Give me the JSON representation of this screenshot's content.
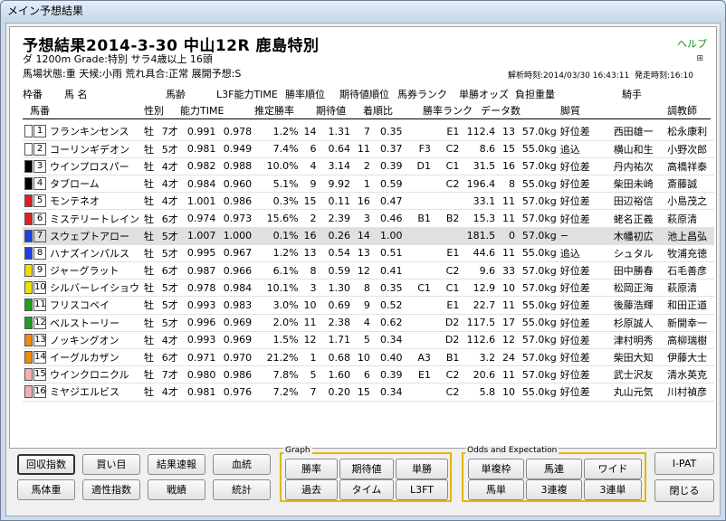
{
  "window_title": "メイン予想結果",
  "header": {
    "title": "予想結果2014-3-30 中山12R 鹿島特別",
    "help": "ヘルプ",
    "info_line1": "ダ 1200m  Grade:特別 サラ4歳以上 16頭",
    "info_line2": "馬場状態:重    天候:小雨    荒れ具合:正常    展開予想:S",
    "analysis_time": "解析時刻:2014/03/30 16:43:11",
    "post_time": "発走時刻:16:10",
    "mini_icon": "⊞"
  },
  "columns_top": [
    "枠番",
    "馬 名",
    "馬齢",
    "L3F能力TIME",
    "勝率順位",
    "期待値順位",
    "馬券ランク",
    "単勝オッズ",
    "負担重量",
    "騎手"
  ],
  "columns_bottom": [
    "馬番",
    "性別",
    "能力TIME",
    "推定勝率",
    "期待値",
    "着順比",
    "勝率ランク",
    "データ数",
    "脚質",
    "調教師"
  ],
  "rows": [
    {
      "waku": "1",
      "waku_color": "#ffffff",
      "uma": "1",
      "name": "フランキンセンス",
      "sex": "牡",
      "age": "7才",
      "time": "0.991",
      "l3f": "0.978",
      "winrate": "1.2%",
      "wrank": "14",
      "ev": "1.31",
      "evrank": "7",
      "ratio": "0.35",
      "bet": "",
      "rate": "E1",
      "odds": "112.4",
      "data": "13",
      "weight": "57.0kg",
      "style": "好位差",
      "jockey": "西田雄一",
      "trainer": "松永康利"
    },
    {
      "waku": "1",
      "waku_color": "#ffffff",
      "uma": "2",
      "name": "コーリンギデオン",
      "sex": "牡",
      "age": "5才",
      "time": "0.981",
      "l3f": "0.949",
      "winrate": "7.4%",
      "wrank": "6",
      "ev": "0.64",
      "evrank": "11",
      "ratio": "0.37",
      "bet": "F3",
      "rate": "C2",
      "odds": "8.6",
      "data": "15",
      "weight": "55.0kg",
      "style": "追込",
      "jockey": "横山和生",
      "trainer": "小野次郎"
    },
    {
      "waku": "2",
      "waku_color": "#000000",
      "uma": "3",
      "name": "ウインプロスパー",
      "sex": "牡",
      "age": "4才",
      "time": "0.982",
      "l3f": "0.988",
      "winrate": "10.0%",
      "wrank": "4",
      "ev": "3.14",
      "evrank": "2",
      "ratio": "0.39",
      "bet": "D1",
      "rate": "C1",
      "odds": "31.5",
      "data": "16",
      "weight": "57.0kg",
      "style": "好位差",
      "jockey": "丹内祐次",
      "trainer": "高橋祥泰"
    },
    {
      "waku": "2",
      "waku_color": "#000000",
      "uma": "4",
      "name": "タブローム",
      "sex": "牡",
      "age": "4才",
      "time": "0.984",
      "l3f": "0.960",
      "winrate": "5.1%",
      "wrank": "9",
      "ev": "9.92",
      "evrank": "1",
      "ratio": "0.59",
      "bet": "",
      "rate": "C2",
      "odds": "196.4",
      "data": "8",
      "weight": "55.0kg",
      "style": "好位差",
      "jockey": "柴田未崎",
      "trainer": "斎藤誠"
    },
    {
      "waku": "3",
      "waku_color": "#e02020",
      "uma": "5",
      "name": "モンテネオ",
      "sex": "牡",
      "age": "4才",
      "time": "1.001",
      "l3f": "0.986",
      "winrate": "0.3%",
      "wrank": "15",
      "ev": "0.11",
      "evrank": "16",
      "ratio": "0.47",
      "bet": "",
      "rate": "",
      "odds": "33.1",
      "data": "11",
      "weight": "57.0kg",
      "style": "好位差",
      "jockey": "田辺裕信",
      "trainer": "小島茂之"
    },
    {
      "waku": "3",
      "waku_color": "#e02020",
      "uma": "6",
      "name": "ミステリートレイン",
      "sex": "牡",
      "age": "6才",
      "time": "0.974",
      "l3f": "0.973",
      "winrate": "15.6%",
      "wrank": "2",
      "ev": "2.39",
      "evrank": "3",
      "ratio": "0.46",
      "bet": "B1",
      "rate": "B2",
      "odds": "15.3",
      "data": "11",
      "weight": "57.0kg",
      "style": "好位差",
      "jockey": "蛯名正義",
      "trainer": "萩原清"
    },
    {
      "waku": "4",
      "waku_color": "#2040e0",
      "uma": "7",
      "name": "スウェプトアロー",
      "sex": "牡",
      "age": "5才",
      "time": "1.007",
      "l3f": "1.000",
      "winrate": "0.1%",
      "wrank": "16",
      "ev": "0.26",
      "evrank": "14",
      "ratio": "1.00",
      "bet": "",
      "rate": "",
      "odds": "181.5",
      "data": "0",
      "weight": "57.0kg",
      "style": "−",
      "jockey": "木幡初広",
      "trainer": "池上昌弘",
      "hl": true
    },
    {
      "waku": "4",
      "waku_color": "#2040e0",
      "uma": "8",
      "name": "ハナズインパルス",
      "sex": "牡",
      "age": "5才",
      "time": "0.995",
      "l3f": "0.967",
      "winrate": "1.2%",
      "wrank": "13",
      "ev": "0.54",
      "evrank": "13",
      "ratio": "0.51",
      "bet": "",
      "rate": "E1",
      "odds": "44.6",
      "data": "11",
      "weight": "55.0kg",
      "style": "追込",
      "jockey": "シュタル",
      "trainer": "牧浦充徳"
    },
    {
      "waku": "5",
      "waku_color": "#f0e000",
      "uma": "9",
      "name": "ジャーグラット",
      "sex": "牡",
      "age": "6才",
      "time": "0.987",
      "l3f": "0.966",
      "winrate": "6.1%",
      "wrank": "8",
      "ev": "0.59",
      "evrank": "12",
      "ratio": "0.41",
      "bet": "",
      "rate": "C2",
      "odds": "9.6",
      "data": "33",
      "weight": "57.0kg",
      "style": "好位差",
      "jockey": "田中勝春",
      "trainer": "石毛善彦"
    },
    {
      "waku": "5",
      "waku_color": "#f0e000",
      "uma": "10",
      "name": "シルバーレイショウ",
      "sex": "牡",
      "age": "5才",
      "time": "0.978",
      "l3f": "0.984",
      "winrate": "10.1%",
      "wrank": "3",
      "ev": "1.30",
      "evrank": "8",
      "ratio": "0.35",
      "bet": "C1",
      "rate": "C1",
      "odds": "12.9",
      "data": "10",
      "weight": "57.0kg",
      "style": "好位差",
      "jockey": "松岡正海",
      "trainer": "萩原清"
    },
    {
      "waku": "6",
      "waku_color": "#20a020",
      "uma": "11",
      "name": "フリスコベイ",
      "sex": "牡",
      "age": "5才",
      "time": "0.993",
      "l3f": "0.983",
      "winrate": "3.0%",
      "wrank": "10",
      "ev": "0.69",
      "evrank": "9",
      "ratio": "0.52",
      "bet": "",
      "rate": "E1",
      "odds": "22.7",
      "data": "11",
      "weight": "55.0kg",
      "style": "好位差",
      "jockey": "後藤浩輝",
      "trainer": "和田正道"
    },
    {
      "waku": "6",
      "waku_color": "#20a020",
      "uma": "12",
      "name": "ベルストーリー",
      "sex": "牡",
      "age": "5才",
      "time": "0.996",
      "l3f": "0.969",
      "winrate": "2.0%",
      "wrank": "11",
      "ev": "2.38",
      "evrank": "4",
      "ratio": "0.62",
      "bet": "",
      "rate": "D2",
      "odds": "117.5",
      "data": "17",
      "weight": "55.0kg",
      "style": "好位差",
      "jockey": "杉原誠人",
      "trainer": "新開幸一"
    },
    {
      "waku": "7",
      "waku_color": "#f08a10",
      "uma": "13",
      "name": "ノッキングオン",
      "sex": "牡",
      "age": "4才",
      "time": "0.993",
      "l3f": "0.969",
      "winrate": "1.5%",
      "wrank": "12",
      "ev": "1.71",
      "evrank": "5",
      "ratio": "0.34",
      "bet": "",
      "rate": "D2",
      "odds": "112.6",
      "data": "12",
      "weight": "57.0kg",
      "style": "好位差",
      "jockey": "津村明秀",
      "trainer": "高柳瑞樹"
    },
    {
      "waku": "7",
      "waku_color": "#f08a10",
      "uma": "14",
      "name": "イーグルカザン",
      "sex": "牡",
      "age": "6才",
      "time": "0.971",
      "l3f": "0.970",
      "winrate": "21.2%",
      "wrank": "1",
      "ev": "0.68",
      "evrank": "10",
      "ratio": "0.40",
      "bet": "A3",
      "rate": "B1",
      "odds": "3.2",
      "data": "24",
      "weight": "57.0kg",
      "style": "好位差",
      "jockey": "柴田大知",
      "trainer": "伊藤大士"
    },
    {
      "waku": "8",
      "waku_color": "#f6b0b0",
      "uma": "15",
      "name": "ウインクロニクル",
      "sex": "牡",
      "age": "7才",
      "time": "0.980",
      "l3f": "0.986",
      "winrate": "7.8%",
      "wrank": "5",
      "ev": "1.60",
      "evrank": "6",
      "ratio": "0.39",
      "bet": "E1",
      "rate": "C2",
      "odds": "20.6",
      "data": "11",
      "weight": "57.0kg",
      "style": "好位差",
      "jockey": "武士沢友",
      "trainer": "清水英克"
    },
    {
      "waku": "8",
      "waku_color": "#f6b0b0",
      "uma": "16",
      "name": "ミヤジエルビス",
      "sex": "牡",
      "age": "4才",
      "time": "0.981",
      "l3f": "0.976",
      "winrate": "7.2%",
      "wrank": "7",
      "ev": "0.20",
      "evrank": "15",
      "ratio": "0.34",
      "bet": "",
      "rate": "C2",
      "odds": "5.8",
      "data": "10",
      "weight": "55.0kg",
      "style": "好位差",
      "jockey": "丸山元気",
      "trainer": "川村禎彦"
    }
  ],
  "buttons_left": [
    "回収指数",
    "買い目",
    "結果速報",
    "血統",
    "馬体重",
    "適性指数",
    "戦績",
    "統計"
  ],
  "graph_group": {
    "label": "Graph",
    "buttons": [
      "勝率",
      "期待値",
      "単勝",
      "過去",
      "タイム",
      "L3FT"
    ]
  },
  "odds_group": {
    "label": "Odds and Expectation",
    "buttons": [
      "単複枠",
      "馬連",
      "ワイド",
      "馬単",
      "3連複",
      "3連単"
    ]
  },
  "buttons_right": [
    "I-PAT",
    "閉じる"
  ]
}
